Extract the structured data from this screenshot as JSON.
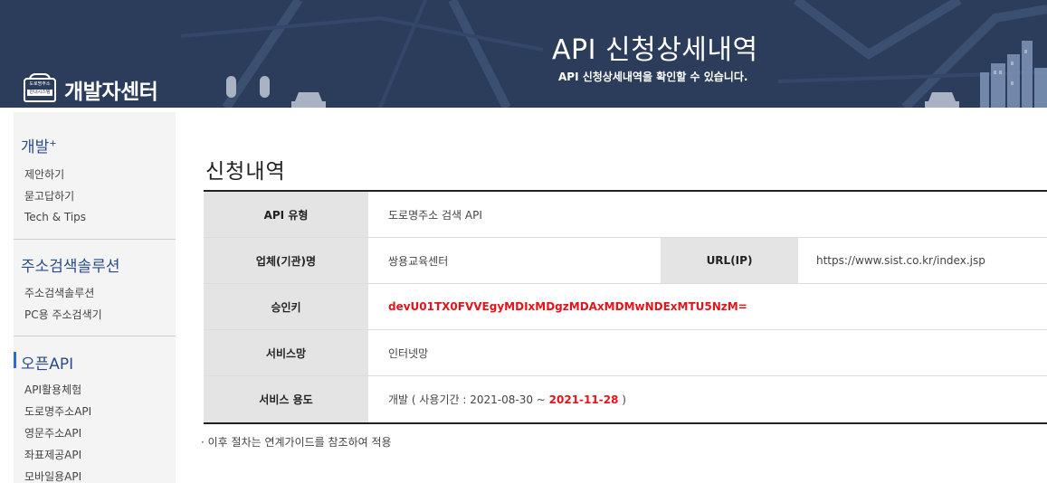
{
  "header": {
    "logo_line1": "도로명주소",
    "logo_line2": "안내시스템",
    "logo_text": "개발자센터",
    "title": "API 신청상세내역",
    "subtitle": "API 신청상세내역을 확인할 수 있습니다."
  },
  "sidebar": {
    "sections": [
      {
        "title": "개발",
        "title_mark": "+",
        "items": [
          "제안하기",
          "묻고답하기",
          "Tech & Tips"
        ]
      },
      {
        "title": "주소검색솔루션",
        "items": [
          "주소검색솔루션",
          "PC용 주소검색기"
        ]
      },
      {
        "title": "오픈API",
        "items": [
          "API활용체험",
          "도로명주소API",
          "영문주소API",
          "좌표제공API",
          "모바일용API"
        ]
      }
    ]
  },
  "main": {
    "title": "신청내역",
    "rows": {
      "api_type": {
        "label": "API 유형",
        "value": "도로명주소 검색 API"
      },
      "company": {
        "label": "업체(기관)명",
        "value": "쌍용교육센터"
      },
      "url": {
        "label": "URL(IP)",
        "value": "https://www.sist.co.kr/index.jsp"
      },
      "approval_key": {
        "label": "승인키",
        "value": "devU01TX0FVVEgyMDIxMDgzMDAxMDMwNDExMTU5NzM="
      },
      "service_network": {
        "label": "서비스망",
        "value": "인터넷망"
      },
      "service_usage": {
        "label": "서비스 용도",
        "prefix": "개발 ( 사용기간 : 2021-08-30 ~ ",
        "end_date": "2021-11-28",
        "suffix": " )"
      }
    },
    "note": "· 이후 절차는 연계가이드를 참조하여 적용"
  },
  "colors": {
    "header_bg": "#2c3d5c",
    "sidebar_bg": "#f4f4f4",
    "heading_blue": "#2a4b8c",
    "accent_red": "#e3141b",
    "table_header_bg": "#e4e4e4"
  }
}
